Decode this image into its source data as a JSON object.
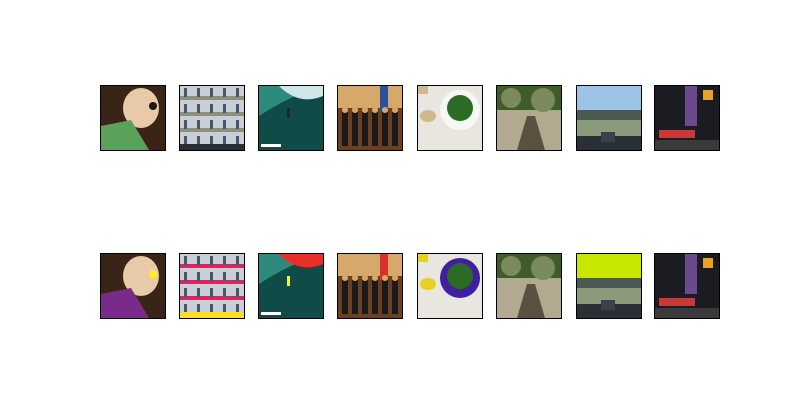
{
  "figure": {
    "rows": [
      {
        "id": "original",
        "images": [
          {
            "subject": "baby",
            "palette": [
              "#3a2418",
              "#e8c9a8",
              "#5aa25a",
              "#1e1612"
            ]
          },
          {
            "subject": "street-collage",
            "palette": [
              "#c8cfd6",
              "#4a5668",
              "#8c8f7a",
              "#2b2f38"
            ]
          },
          {
            "subject": "surfer-wave",
            "palette": [
              "#2f8a7e",
              "#0f4b47",
              "#cfe6ea",
              "#1b2a2a"
            ]
          },
          {
            "subject": "group-photo",
            "palette": [
              "#6a3f22",
              "#d6a86a",
              "#1a1a1a",
              "#2d4fa0"
            ]
          },
          {
            "subject": "salad-plate",
            "palette": [
              "#e9e6df",
              "#2c6b25",
              "#cdb98b",
              "#f7f7f5"
            ]
          },
          {
            "subject": "garden-path",
            "palette": [
              "#7b8a5d",
              "#3f5d2a",
              "#b3a890",
              "#5b5142"
            ]
          },
          {
            "subject": "bridge-road",
            "palette": [
              "#9cc4e6",
              "#4a5a52",
              "#2b3036",
              "#8a9a7a"
            ]
          },
          {
            "subject": "market-boat",
            "palette": [
              "#1b1c22",
              "#c83a3a",
              "#e8a22a",
              "#6a4a8a"
            ]
          }
        ]
      },
      {
        "id": "perturbed",
        "images": [
          {
            "subject": "baby",
            "palette": [
              "#3a2418",
              "#e8c9a8",
              "#7a2a8a",
              "#ffee22"
            ]
          },
          {
            "subject": "street-collage",
            "palette": [
              "#c8cfd6",
              "#4a5668",
              "#e02060",
              "#ffe020"
            ]
          },
          {
            "subject": "surfer-wave",
            "palette": [
              "#2f8a7e",
              "#0f4b47",
              "#e8302a",
              "#f2f04a"
            ]
          },
          {
            "subject": "group-photo",
            "palette": [
              "#6a3f22",
              "#d6a86a",
              "#1a1a1a",
              "#d8302a"
            ]
          },
          {
            "subject": "salad-plate",
            "palette": [
              "#e9e6df",
              "#2c6b25",
              "#e8d020",
              "#4020a0"
            ]
          },
          {
            "subject": "garden-path",
            "palette": [
              "#7b8a5d",
              "#3f5d2a",
              "#b3a890",
              "#5b5142"
            ]
          },
          {
            "subject": "bridge-road",
            "palette": [
              "#c8e800",
              "#4a5a52",
              "#2b3036",
              "#8a9a7a"
            ]
          },
          {
            "subject": "market-boat",
            "palette": [
              "#1b1c22",
              "#c83a3a",
              "#e8a22a",
              "#6a4a8a"
            ]
          }
        ]
      }
    ]
  }
}
